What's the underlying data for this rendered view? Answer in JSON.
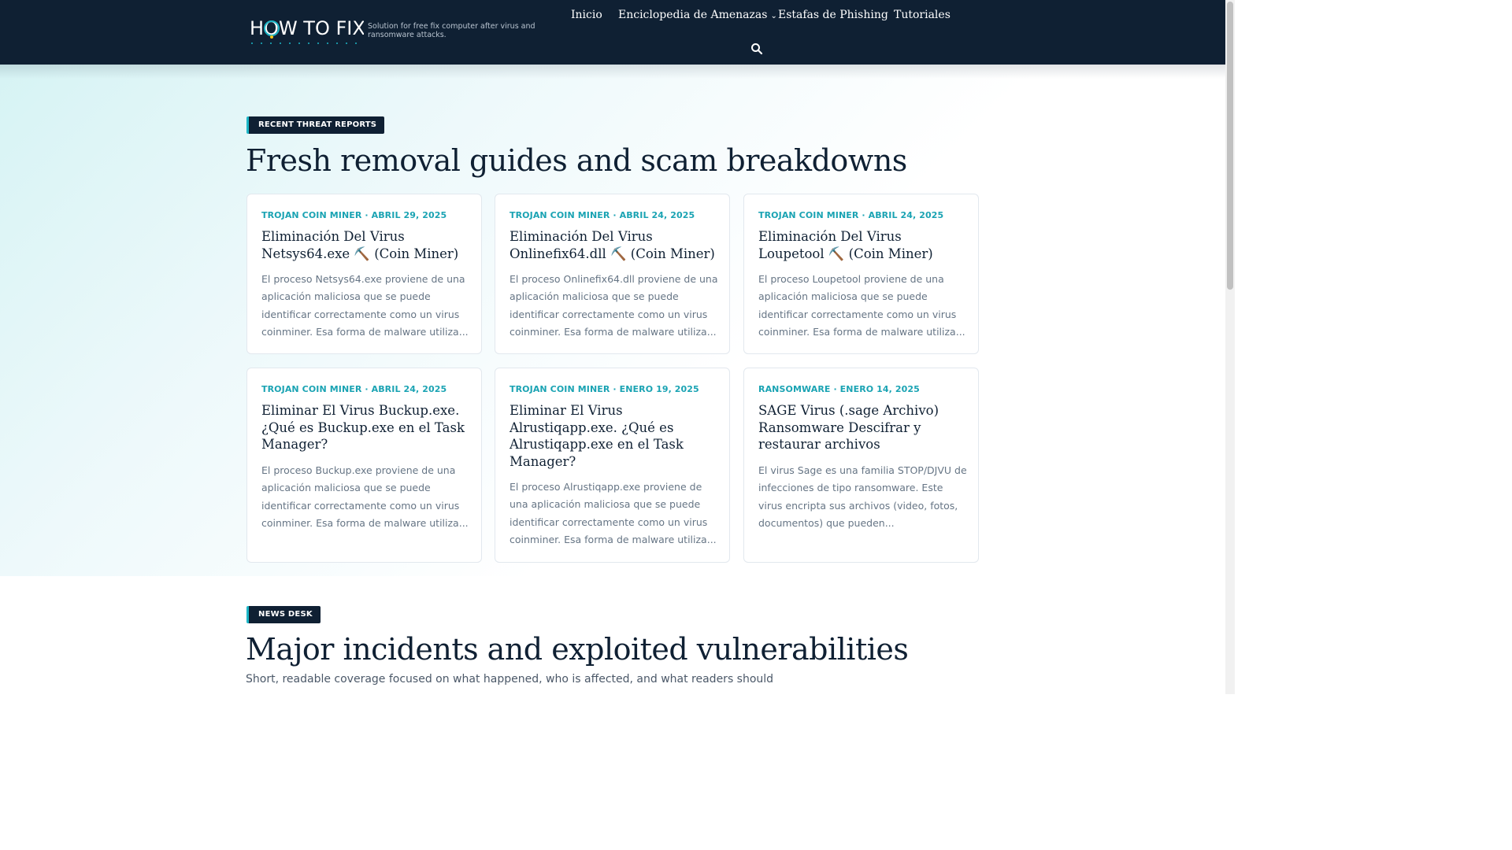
{
  "header": {
    "logo_text": "HOW TO FIX",
    "tagline": "Solution for free fix computer after virus and ransomware attacks.",
    "nav": [
      {
        "label": "Inicio"
      },
      {
        "label": "Enciclopedia de Amenazas",
        "has_dropdown": true
      },
      {
        "label": "Estafas de Phishing"
      },
      {
        "label": "Tutoriales"
      }
    ],
    "search_icon": "search-icon"
  },
  "recent": {
    "badge": "RECENT THREAT REPORTS",
    "title": "Fresh removal guides and scam breakdowns",
    "cards": [
      {
        "meta": "TROJAN COIN MINER · ABRIL 29, 2025",
        "title": "Eliminación Del Virus Netsys64.exe ⛏️ (Coin Miner)",
        "excerpt": "El proceso Netsys64.exe proviene de una aplicación maliciosa que se puede identificar correctamente como un virus coinminer. Esa forma de malware utiliza..."
      },
      {
        "meta": "TROJAN COIN MINER · ABRIL 24, 2025",
        "title": "Eliminación Del Virus Onlinefix64.dll ⛏️ (Coin Miner)",
        "excerpt": "El proceso Onlinefix64.dll proviene de una aplicación maliciosa que se puede identificar correctamente como un virus coinminer. Esa forma de malware utiliza..."
      },
      {
        "meta": "TROJAN COIN MINER · ABRIL 24, 2025",
        "title": "Eliminación Del Virus Loupetool ⛏️ (Coin Miner)",
        "excerpt": "El proceso Loupetool proviene de una aplicación maliciosa que se puede identificar correctamente como un virus coinminer. Esa forma de malware utiliza..."
      },
      {
        "meta": "TROJAN COIN MINER · ABRIL 24, 2025",
        "title": "Eliminar El Virus Buckup.exe. ¿Qué es Buckup.exe en el Task Manager?",
        "excerpt": "El proceso Buckup.exe proviene de una aplicación maliciosa que se puede identificar correctamente como un virus coinminer. Esa forma de malware utiliza..."
      },
      {
        "meta": "TROJAN COIN MINER · ENERO 19, 2025",
        "title": "Eliminar El Virus Alrustiqapp.exe. ¿Qué es Alrustiqapp.exe en el Task Manager?",
        "excerpt": "El proceso Alrustiqapp.exe proviene de una aplicación maliciosa que se puede identificar correctamente como un virus coinminer. Esa forma de malware utiliza..."
      },
      {
        "meta": "RANSOMWARE · ENERO 14, 2025",
        "title": "SAGE Virus (.sage Archivo) Ransomware Descifrar y restaurar archivos",
        "excerpt": "El virus Sage es una familia STOP/DJVU de infecciones de tipo ransomware. Este virus encripta sus archivos (video, fotos, documentos) que pueden..."
      }
    ]
  },
  "news": {
    "badge": "NEWS DESK",
    "title": "Major incidents and exploited vulnerabilities",
    "subtitle": "Short, readable coverage focused on what happened, who is affected, and what readers should"
  },
  "colors": {
    "header_bg": "#0f2033",
    "accent": "#1aa3b3",
    "title_text": "#0f2033",
    "excerpt_text": "#667585"
  }
}
